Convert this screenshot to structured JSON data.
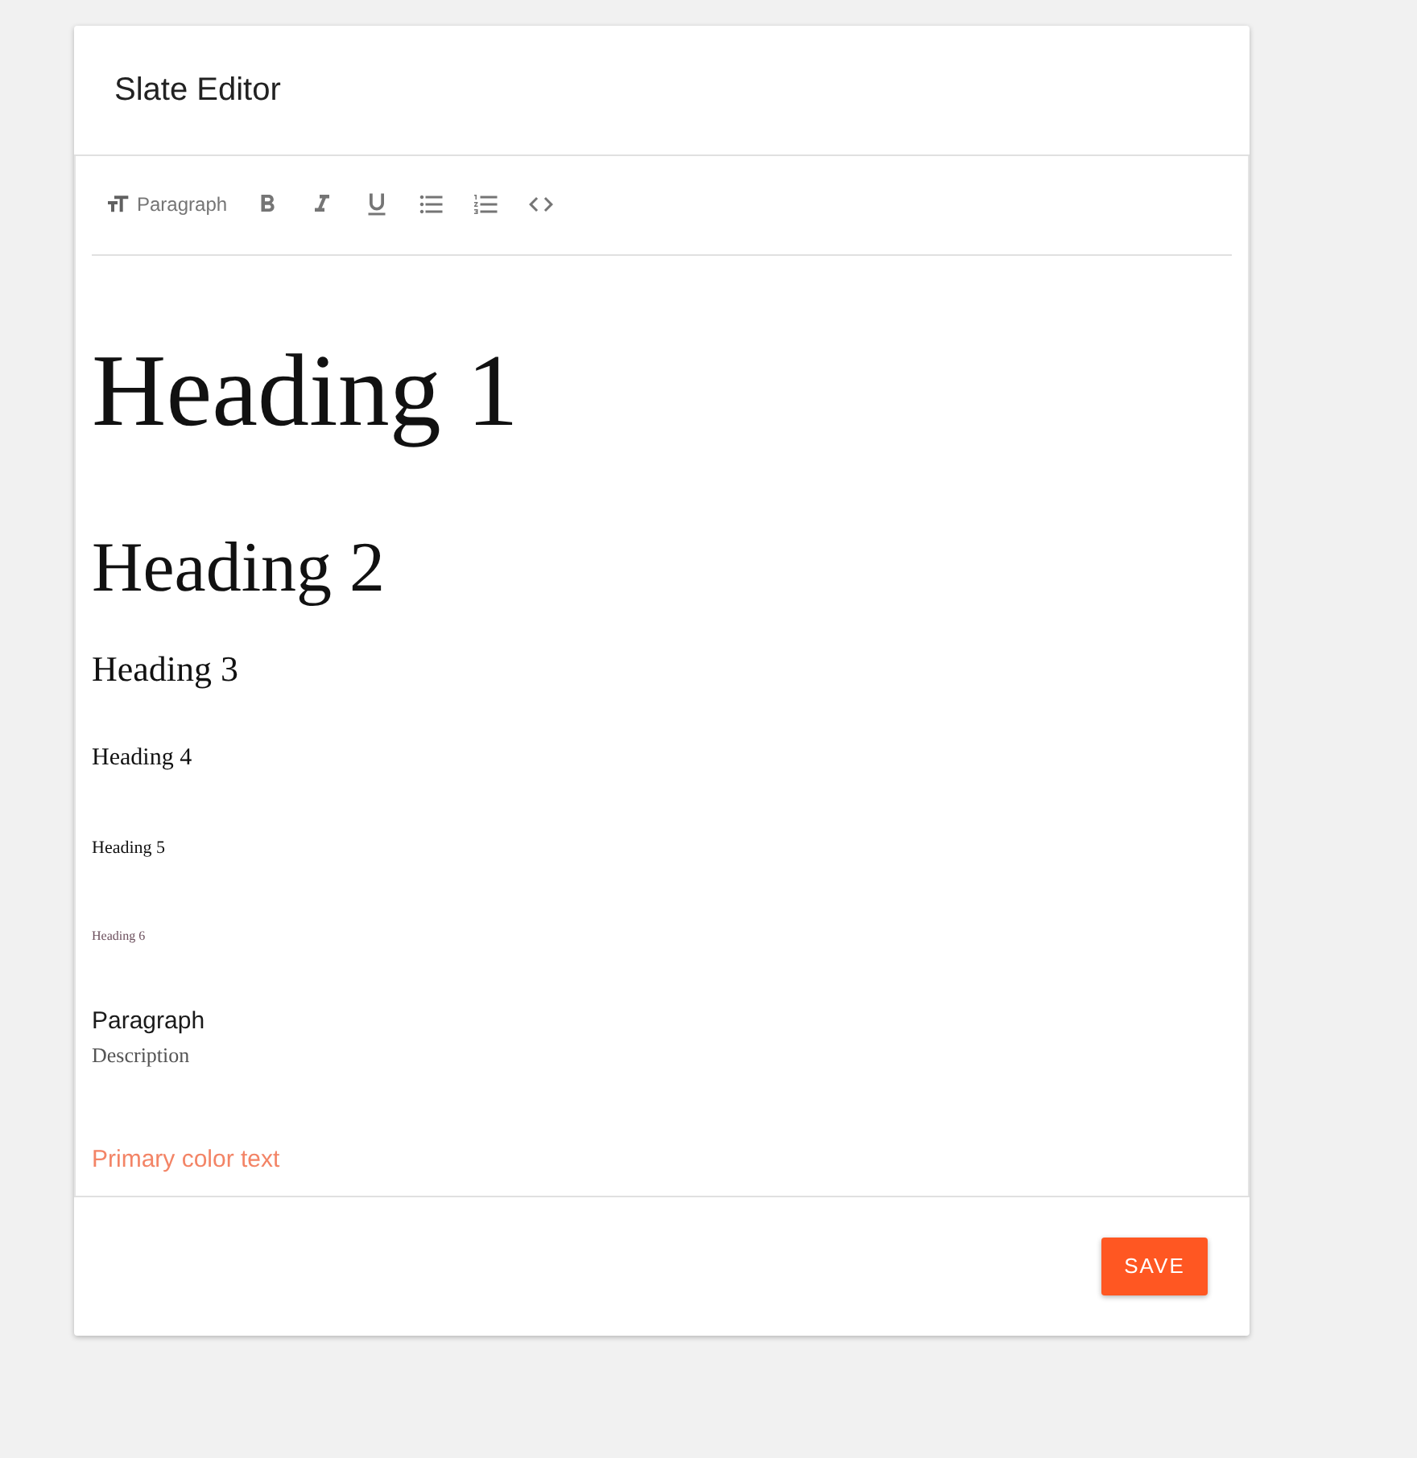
{
  "card": {
    "title": "Slate Editor"
  },
  "toolbar": {
    "block_type": {
      "label": "Paragraph"
    },
    "buttons": [
      {
        "kind": "bold"
      },
      {
        "kind": "italic"
      },
      {
        "kind": "underline"
      },
      {
        "kind": "bulleted-list"
      },
      {
        "kind": "numbered-list"
      },
      {
        "kind": "code"
      }
    ]
  },
  "content": [
    {
      "kind": "heading1",
      "text": "Heading 1"
    },
    {
      "kind": "heading2",
      "text": "Heading 2"
    },
    {
      "kind": "heading3",
      "text": "Heading 3"
    },
    {
      "kind": "heading4",
      "text": "Heading 4"
    },
    {
      "kind": "heading5",
      "text": "Heading 5"
    },
    {
      "kind": "heading6",
      "text": "Heading 6"
    },
    {
      "kind": "paragraph",
      "text": "Paragraph"
    },
    {
      "kind": "description",
      "text": "Description"
    },
    {
      "kind": "primary",
      "text": "Primary color text"
    }
  ],
  "footer": {
    "save_button": "SAVE"
  }
}
